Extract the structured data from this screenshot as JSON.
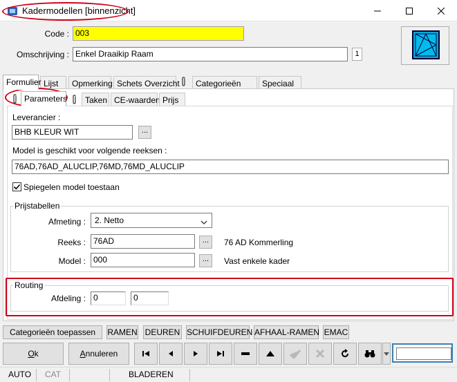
{
  "window": {
    "title": "Kadermodellen [binnenzicht]"
  },
  "header": {
    "code_label": "Code :",
    "code_value": "003",
    "omschrijving_label": "Omschrijving :",
    "omschrijving_value": "Enkel Draaikip Raam",
    "counter_value": "1"
  },
  "tabs": [
    "Formulier",
    "Lijst",
    "Opmerking",
    "Schets Overzicht",
    "Categorieën",
    "Speciaal"
  ],
  "subtabs": [
    "Parameters",
    "Taken",
    "CE-waarden",
    "Prijs"
  ],
  "parameters": {
    "leverancier_label": "Leverancier :",
    "leverancier_value": "BHB KLEUR  WIT",
    "ellipsis": "...",
    "reeksen_label": "Model is geschikt voor volgende reeksen :",
    "reeksen_value": "76AD,76AD_ALUCLIP,76MD,76MD_ALUCLIP",
    "spiegelen_label": "Spiegelen model toestaan",
    "spiegelen_checked": true
  },
  "prijstabellen": {
    "title": "Prijstabellen",
    "afmeting_label": "Afmeting :",
    "afmeting_value": "2.  Netto",
    "reeks_label": "Reeks :",
    "reeks_value": "76AD",
    "reeks_desc": "76 AD Kommerling",
    "model_label": "Model :",
    "model_value": "000",
    "model_desc": "Vast enkele kader"
  },
  "routing": {
    "title": "Routing",
    "afdeling_label": "Afdeling :",
    "afdeling_value1": "0",
    "afdeling_value2": "0"
  },
  "category_buttons": [
    "Categorieën toepassen",
    "RAMEN",
    "DEUREN",
    "SCHUIFDEUREN",
    "AFHAAL-RAMEN",
    "EMAC"
  ],
  "actions": {
    "ok": "Ok",
    "ok_mnemonic": "O",
    "ok_rest": "k",
    "annuleren": "Annuleren",
    "annuleren_mnemonic": "A",
    "annuleren_rest": "nnuleren"
  },
  "statusbar": {
    "auto": "AUTO",
    "cat": "CAT",
    "mode": "BLADEREN"
  },
  "colors": {
    "highlight": "#ffff00",
    "annotation": "#d0021b",
    "preview": "#00aadd"
  }
}
